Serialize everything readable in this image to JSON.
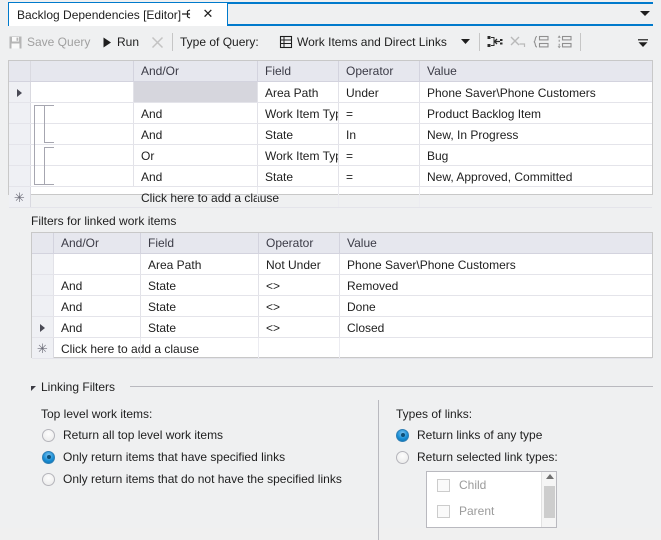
{
  "window": {
    "tab_title": "Backlog Dependencies [Editor]",
    "pin_icon": "pin-icon",
    "close_icon": "close-icon",
    "overflow_icon": "chevron-down-icon",
    "accent_color": "#007acc",
    "background_color": "#eff0f1"
  },
  "toolbar": {
    "save_query_label": "Save Query",
    "save_query_icon": "save-disk-icon",
    "run_label": "Run",
    "run_icon": "play-icon",
    "stop_icon": "cancel-x-icon",
    "type_of_query_label": "Type of Query:",
    "query_type_value": "Work Items and Direct Links",
    "query_type_icon": "grid-table-icon",
    "query_type_dropdown_icon": "chevron-down-icon",
    "icons": [
      {
        "name": "insert-link-clause-icon"
      },
      {
        "name": "delete-clause-icon"
      },
      {
        "name": "group-clause-icon"
      },
      {
        "name": "ungroup-clause-icon"
      }
    ],
    "overflow_icon": "toolbar-overflow-icon"
  },
  "top_grid": {
    "columns": [
      "And/Or",
      "Field",
      "Operator",
      "Value"
    ],
    "rows": [
      {
        "selected": true,
        "andor": "",
        "field": "Area Path",
        "operator": "Under",
        "value": "Phone Saver\\Phone Customers",
        "andor_gray": true
      },
      {
        "selected": false,
        "andor": "And",
        "field": "Work Item Type",
        "operator": "=",
        "value": "Product Backlog Item"
      },
      {
        "selected": false,
        "andor": "And",
        "field": "State",
        "operator": "In",
        "value": "New, In Progress"
      },
      {
        "selected": false,
        "andor": "Or",
        "field": "Work Item Type",
        "operator": "=",
        "value": "Bug"
      },
      {
        "selected": false,
        "andor": "And",
        "field": "State",
        "operator": "=",
        "value": "New, Approved, Committed"
      }
    ],
    "new_row_text": "Click here to add a clause",
    "new_row_icon": "asterisk-new-row-icon"
  },
  "linked_section": {
    "label": "Filters for linked work items",
    "columns": [
      "And/Or",
      "Field",
      "Operator",
      "Value"
    ],
    "rows": [
      {
        "selected": false,
        "andor": "",
        "field": "Area Path",
        "operator": "Not Under",
        "value": "Phone Saver\\Phone Customers"
      },
      {
        "selected": false,
        "andor": "And",
        "field": "State",
        "operator": "<>",
        "value": "Removed"
      },
      {
        "selected": false,
        "andor": "And",
        "field": "State",
        "operator": "<>",
        "value": "Done"
      },
      {
        "selected": true,
        "andor": "And",
        "field": "State",
        "operator": "<>",
        "value": "Closed"
      }
    ],
    "new_row_text": "Click here to add a clause",
    "new_row_icon": "asterisk-new-row-icon"
  },
  "linking_filters": {
    "title": "Linking Filters",
    "expander_icon": "expander-collapse-icon",
    "top_level": {
      "title": "Top level work items:",
      "options": [
        {
          "label": "Return all top level work items",
          "selected": false
        },
        {
          "label": "Only return items that have specified links",
          "selected": true
        },
        {
          "label": "Only return items that do not have the specified links",
          "selected": false
        }
      ]
    },
    "types_of_links": {
      "title": "Types of links:",
      "options": [
        {
          "label": "Return links of any type",
          "selected": true
        },
        {
          "label": "Return selected link types:",
          "selected": false
        }
      ],
      "link_types": [
        {
          "label": "Child",
          "checked": false
        },
        {
          "label": "Parent",
          "checked": false
        }
      ],
      "scroll_up_icon": "scroll-up-arrow-icon"
    }
  }
}
